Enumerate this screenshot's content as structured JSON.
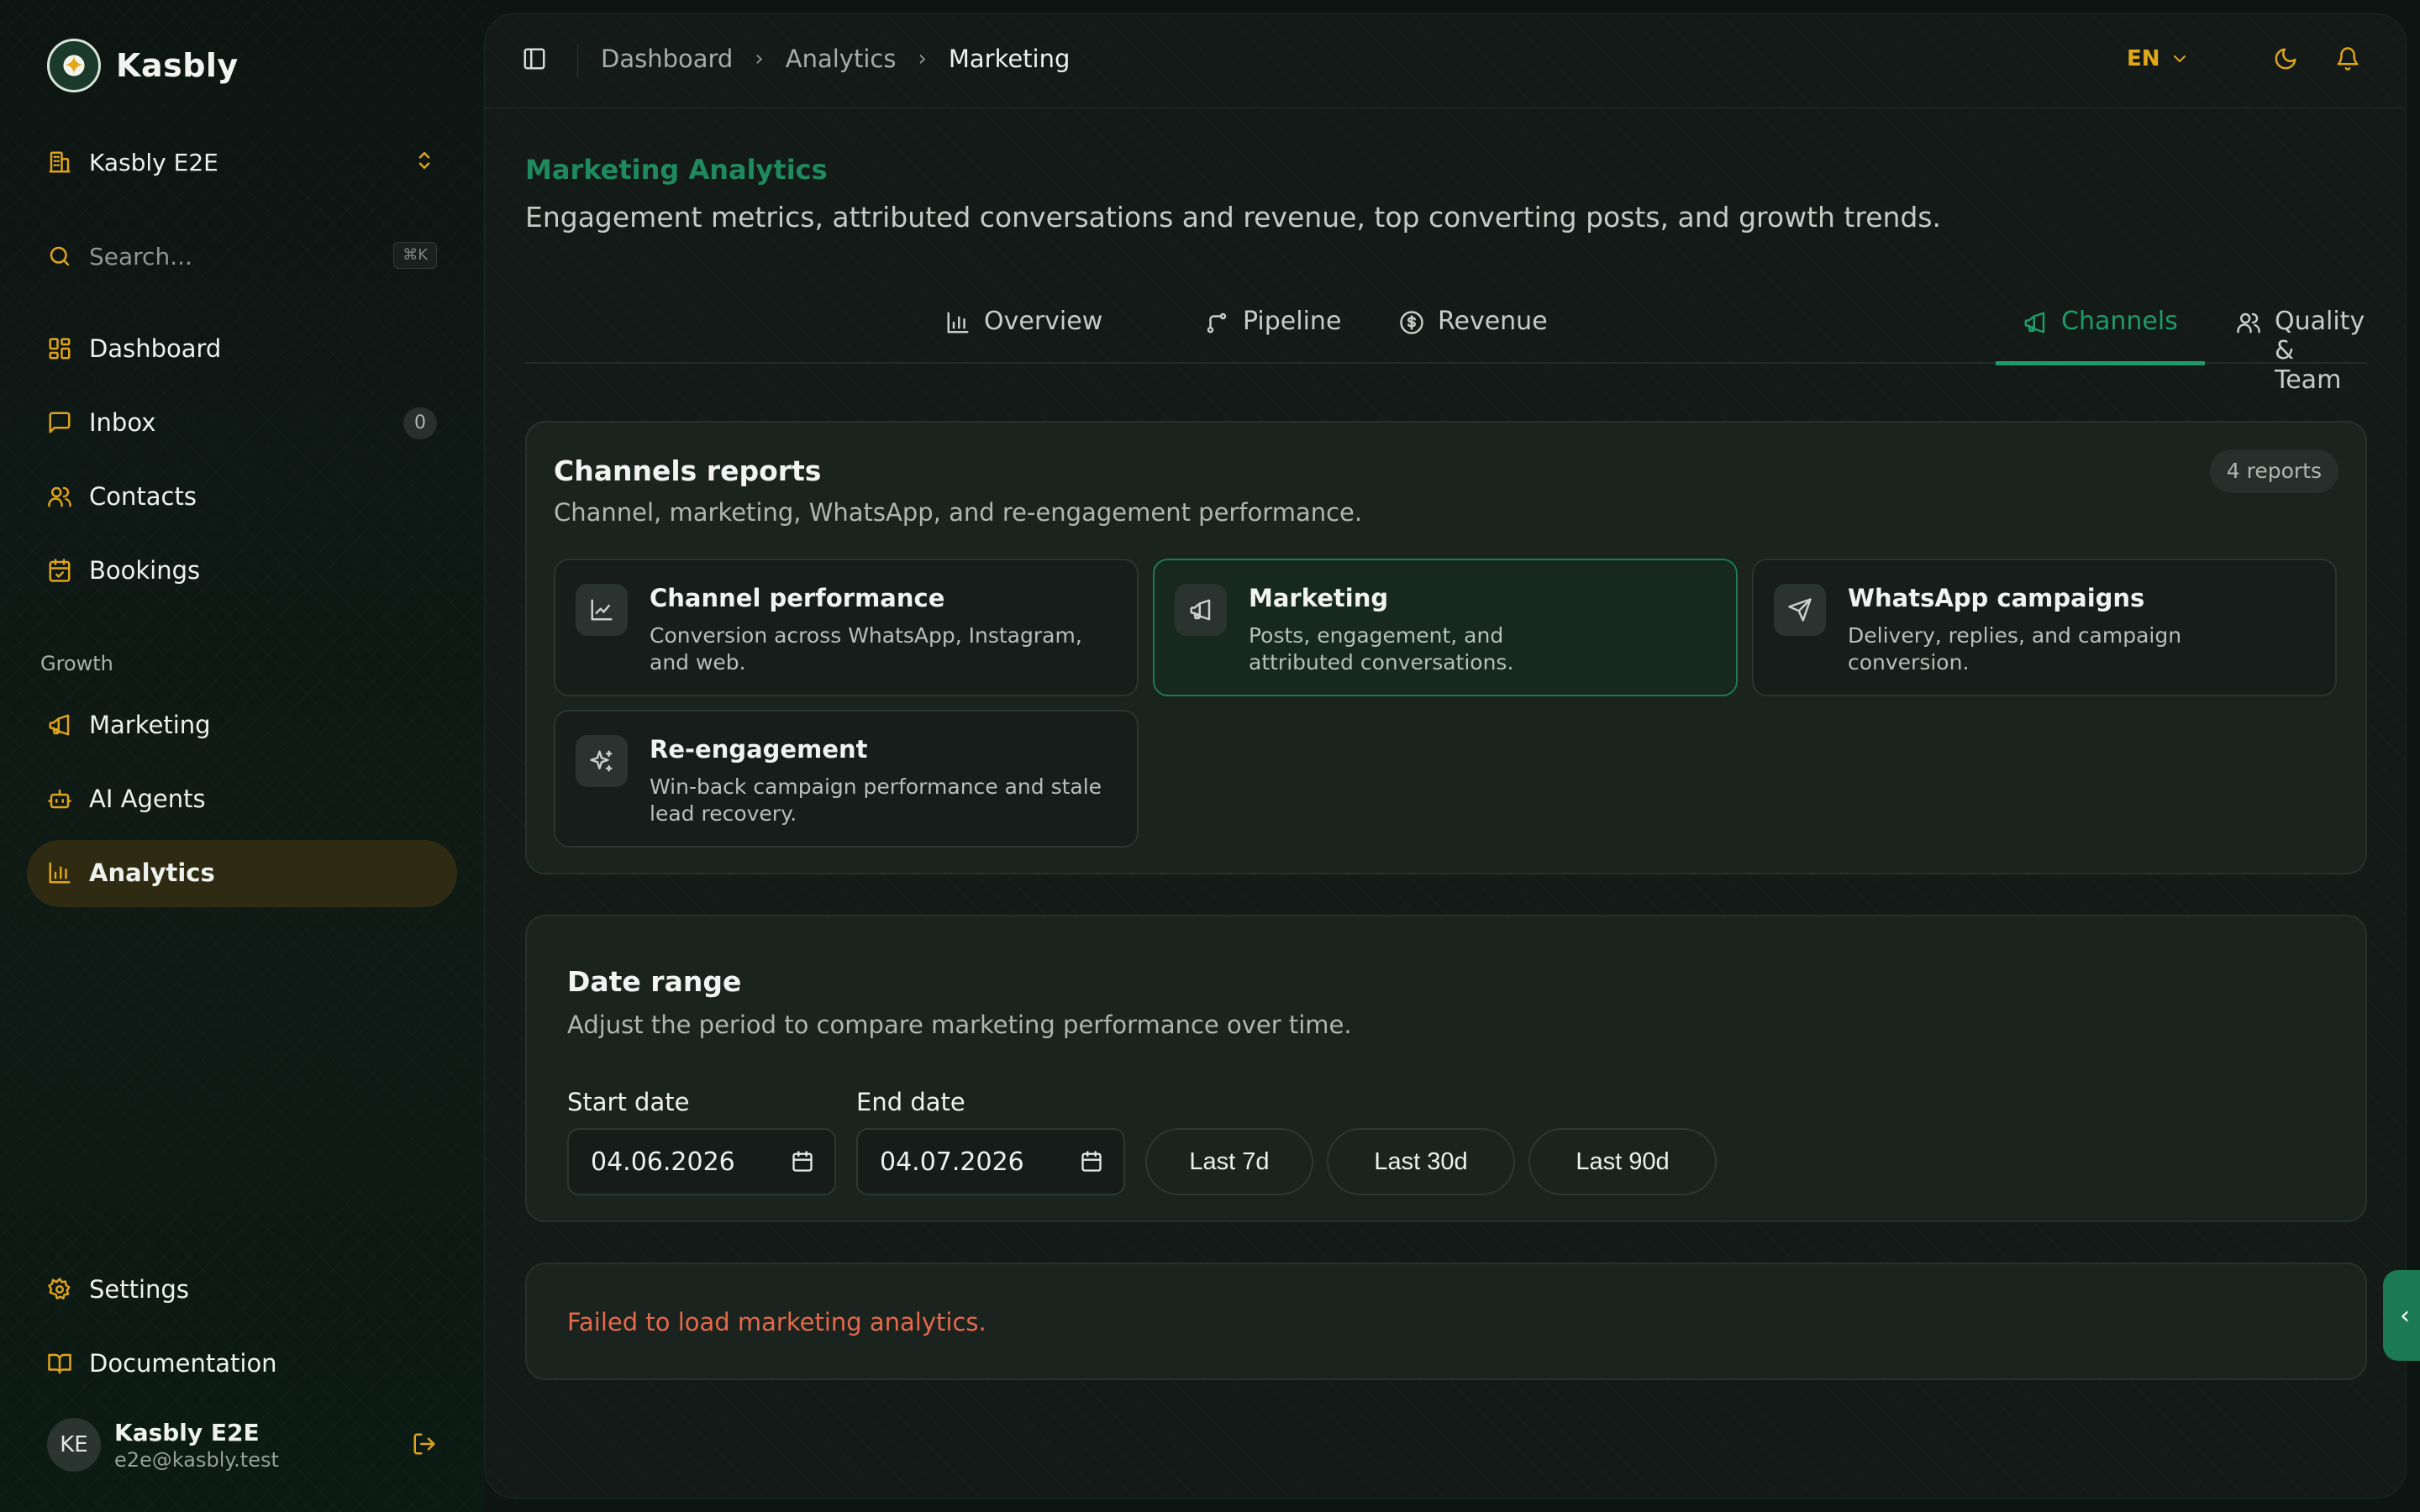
{
  "brand": {
    "name": "Kasbly"
  },
  "workspace": {
    "name": "Kasbly E2E"
  },
  "search": {
    "placeholder": "Search...",
    "shortcut": "⌘K"
  },
  "nav": {
    "primary": [
      {
        "label": "Dashboard",
        "icon": "layout-grid-icon"
      },
      {
        "label": "Inbox",
        "icon": "message-square-icon",
        "badge": "0"
      },
      {
        "label": "Contacts",
        "icon": "users-icon"
      },
      {
        "label": "Bookings",
        "icon": "calendar-check-icon"
      }
    ],
    "growth_label": "Growth",
    "growth": [
      {
        "label": "Marketing",
        "icon": "megaphone-icon"
      },
      {
        "label": "AI Agents",
        "icon": "bot-icon"
      },
      {
        "label": "Analytics",
        "icon": "bar-chart-icon",
        "active": true
      }
    ],
    "footer": [
      {
        "label": "Settings",
        "icon": "gear-icon"
      },
      {
        "label": "Documentation",
        "icon": "book-open-icon"
      }
    ]
  },
  "user": {
    "initials": "KE",
    "name": "Kasbly E2E",
    "email": "e2e@kasbly.test"
  },
  "topbar": {
    "breadcrumb": [
      "Dashboard",
      "Analytics",
      "Marketing"
    ],
    "language": "EN"
  },
  "page": {
    "title": "Marketing Analytics",
    "subtitle": "Engagement metrics, attributed conversations and revenue, top converting posts, and growth trends."
  },
  "tabs": [
    {
      "label": "Overview",
      "icon": "bar-chart-icon"
    },
    {
      "label": "Pipeline",
      "icon": "git-branch-icon"
    },
    {
      "label": "Revenue",
      "icon": "dollar-circle-icon"
    },
    {
      "label": "Channels",
      "icon": "megaphone-icon",
      "active": true
    },
    {
      "label": "Quality & Team",
      "icon": "users-icon"
    }
  ],
  "reports_card": {
    "title": "Channels reports",
    "description": "Channel, marketing, WhatsApp, and re-engagement performance.",
    "count": "4 reports",
    "reports": [
      {
        "title": "Channel performance",
        "description": "Conversion across WhatsApp, Instagram, and web.",
        "icon": "line-chart-icon"
      },
      {
        "title": "Marketing",
        "description": "Posts, engagement, and attributed conversations.",
        "icon": "megaphone-icon",
        "selected": true
      },
      {
        "title": "WhatsApp campaigns",
        "description": "Delivery, replies, and campaign conversion.",
        "icon": "send-icon"
      },
      {
        "title": "Re-engagement",
        "description": "Win-back campaign performance and stale lead recovery.",
        "icon": "sparkles-icon"
      }
    ]
  },
  "date_range": {
    "title": "Date range",
    "description": "Adjust the period to compare marketing performance over time.",
    "start_label": "Start date",
    "start_value": "04.06.2026",
    "end_label": "End date",
    "end_value": "04.07.2026",
    "presets": [
      "Last 7d",
      "Last 30d",
      "Last 90d"
    ]
  },
  "error": {
    "message": "Failed to load marketing analytics."
  },
  "colors": {
    "accent_green": "#1f9a69",
    "accent_amber": "#e0a31c",
    "error": "#e5694a",
    "active_nav_bg": "#2f2b12"
  }
}
